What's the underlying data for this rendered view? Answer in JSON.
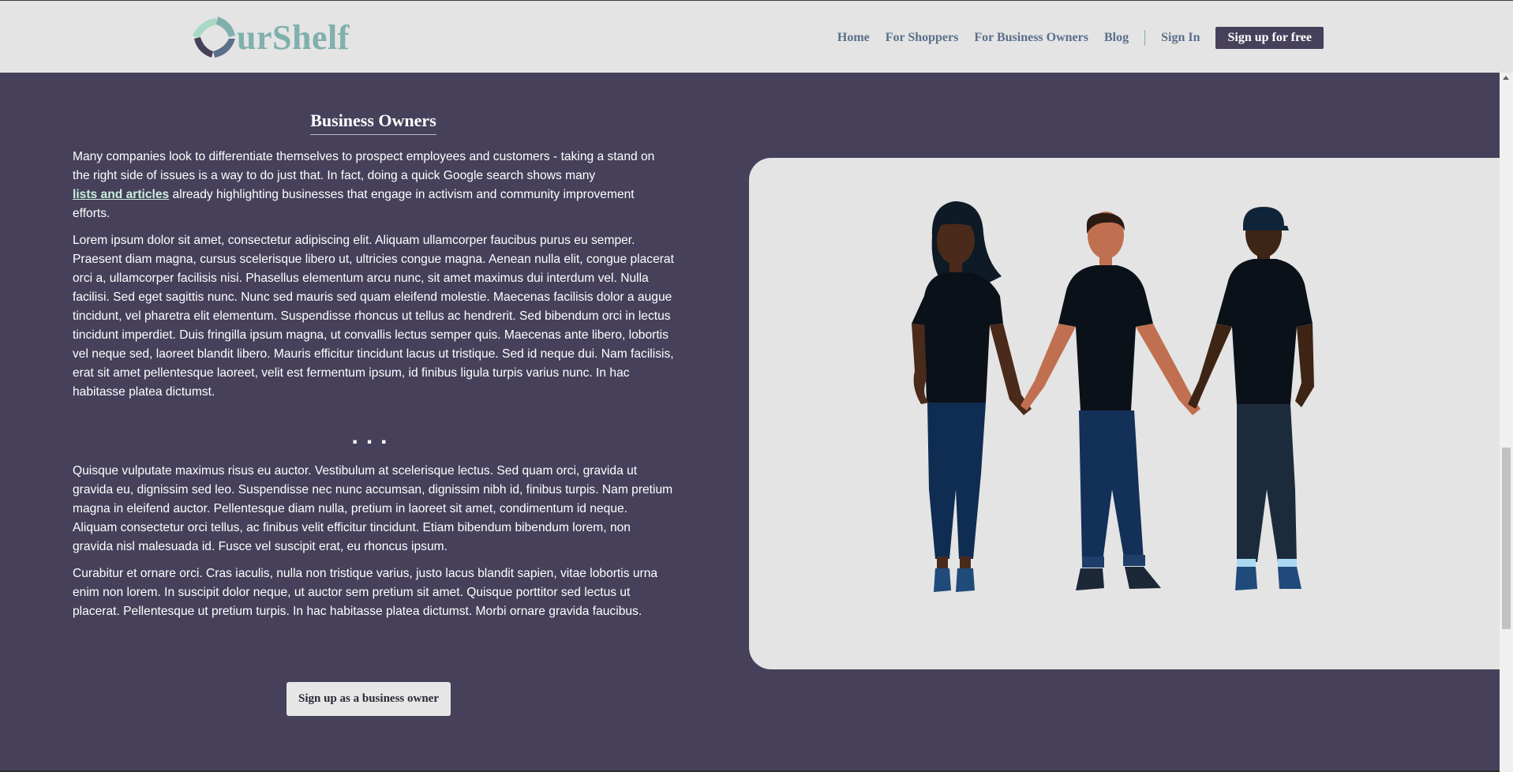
{
  "header": {
    "logo_text": "urShelf",
    "nav": {
      "home": "Home",
      "for_shoppers": "For Shoppers",
      "for_business_owners": "For Business Owners",
      "blog": "Blog",
      "sign_in": "Sign In",
      "sign_up": "Sign up for free"
    }
  },
  "main": {
    "title": "Business Owners",
    "para1_before": "Many companies look to differentiate themselves to prospect employees and customers - taking a stand on the right side of issues is a way to do just that. In fact, doing a quick Google search shows many",
    "para1_link": "lists and articles",
    "para1_after": " already highlighting businesses that engage in activism and community improvement efforts.",
    "para2": "Lorem ipsum dolor sit amet, consectetur adipiscing elit. Aliquam ullamcorper faucibus purus eu semper. Praesent diam magna, cursus scelerisque libero ut, ultricies congue magna. Aenean nulla elit, congue placerat orci a, ullamcorper facilisis nisi. Phasellus elementum arcu nunc, sit amet maximus dui interdum vel. Nulla facilisi. Sed eget sagittis nunc. Nunc sed mauris sed quam eleifend molestie. Maecenas facilisis dolor a augue tincidunt, vel pharetra elit elementum. Suspendisse rhoncus ut tellus ac hendrerit. Sed bibendum orci in lectus tincidunt imperdiet. Duis fringilla ipsum magna, ut convallis lectus semper quis. Maecenas ante libero, lobortis vel neque sed, laoreet blandit libero. Mauris efficitur tincidunt lacus ut tristique. Sed id neque dui. Nam facilisis, erat sit amet pellentesque laoreet, velit est fermentum ipsum, id finibus ligula turpis varius nunc. In hac habitasse platea dictumst.",
    "ellipsis": "...",
    "para3": "Quisque vulputate maximus risus eu auctor. Vestibulum at scelerisque lectus. Sed quam orci, gravida ut gravida eu, dignissim sed leo. Suspendisse nec nunc accumsan, dignissim nibh id, finibus turpis. Nam pretium magna in eleifend auctor. Pellentesque diam nulla, pretium in laoreet sit amet, condimentum id neque. Aliquam consectetur orci tellus, ac finibus velit efficitur tincidunt. Etiam bibendum bibendum lorem, non gravida nisl malesuada id. Fusce vel suscipit erat, eu rhoncus ipsum.",
    "para4": "Curabitur et ornare orci. Cras iaculis, nulla non tristique varius, justo lacus blandit sapien, vitae lobortis urna enim non lorem. In suscipit dolor neque, ut auctor sem pretium sit amet. Quisque porttitor sed lectus ut placerat. Pellentesque ut pretium turpis. In hac habitasse platea dictumst. Morbi ornare gravida faucibus.",
    "cta": "Sign up as a business owner"
  },
  "illustration": {
    "icon": "people-holding-hands-illustration"
  },
  "colors": {
    "background": "#46405a",
    "header": "#e4e4e4",
    "logo_teal": "#7fb0ad",
    "nav_text": "#5a6f8a",
    "link": "#c8f0dc"
  }
}
